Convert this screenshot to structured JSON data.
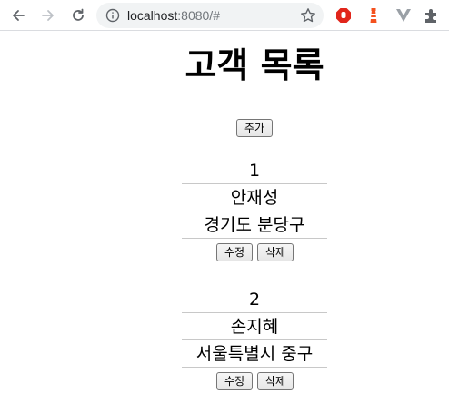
{
  "browser": {
    "url_host": "localhost",
    "url_rest": ":8080/#"
  },
  "page": {
    "title": "고객 목록",
    "add_label": "추가"
  },
  "customers": [
    {
      "id": "1",
      "name": "안재성",
      "address": "경기도 분당구",
      "edit_label": "수정",
      "delete_label": "삭제"
    },
    {
      "id": "2",
      "name": "손지혜",
      "address": "서울특별시 중구",
      "edit_label": "수정",
      "delete_label": "삭제"
    }
  ]
}
